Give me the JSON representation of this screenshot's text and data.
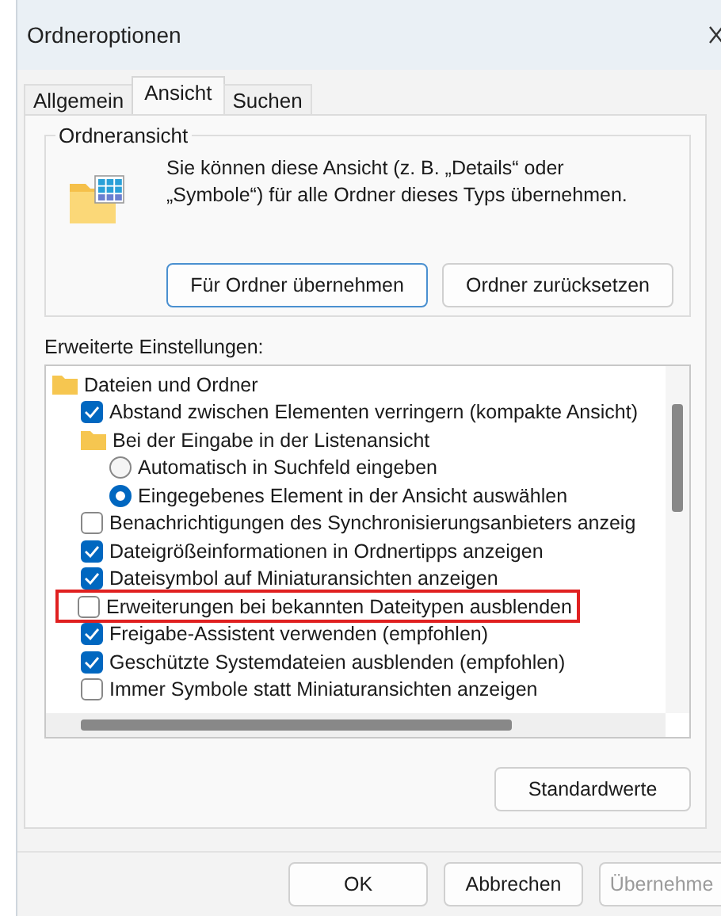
{
  "window": {
    "title": "Ordneroptionen"
  },
  "tabs": [
    {
      "label": "Allgemein",
      "selected": false
    },
    {
      "label": "Ansicht",
      "selected": true
    },
    {
      "label": "Suchen",
      "selected": false
    }
  ],
  "folder_view": {
    "title": "Ordneransicht",
    "description": "Sie können diese Ansicht (z. B. „Details“ oder „Symbole“) für alle Ordner dieses Typs übernehmen.",
    "buttons": [
      {
        "label": "Für Ordner übernehmen",
        "default": true
      },
      {
        "label": "Ordner zurücksetzen",
        "default": false
      }
    ]
  },
  "advanced": {
    "label": "Erweiterte Einstellungen:",
    "items": [
      {
        "kind": "folder",
        "label": "Dateien und Ordner",
        "children": [
          {
            "kind": "checkbox",
            "label": "Abstand zwischen Elementen verringern (kompakte Ansicht)",
            "checked": true,
            "highlighted": false
          },
          {
            "kind": "folder",
            "label": "Bei der Eingabe in der Listenansicht",
            "children": [
              {
                "kind": "radio",
                "label": "Automatisch in Suchfeld eingeben",
                "selected": false
              },
              {
                "kind": "radio",
                "label": "Eingegebenes Element in der Ansicht auswählen",
                "selected": true
              }
            ]
          },
          {
            "kind": "checkbox",
            "label": "Benachrichtigungen des Synchronisierungsanbieters anzeig",
            "checked": false,
            "highlighted": false
          },
          {
            "kind": "checkbox",
            "label": "Dateigrößeinformationen in Ordnertipps anzeigen",
            "checked": true,
            "highlighted": false
          },
          {
            "kind": "checkbox",
            "label": "Dateisymbol auf Miniaturansichten anzeigen",
            "checked": true,
            "highlighted": false
          },
          {
            "kind": "checkbox",
            "label": "Erweiterungen bei bekannten Dateitypen ausblenden",
            "checked": false,
            "highlighted": true
          },
          {
            "kind": "checkbox",
            "label": "Freigabe-Assistent verwenden (empfohlen)",
            "checked": true,
            "highlighted": false
          },
          {
            "kind": "checkbox",
            "label": "Geschützte Systemdateien ausblenden (empfohlen)",
            "checked": true,
            "highlighted": false
          },
          {
            "kind": "checkbox",
            "label": "Immer Symbole statt Miniaturansichten anzeigen",
            "checked": false,
            "highlighted": false
          }
        ]
      }
    ],
    "defaults_button": "Standardwerte"
  },
  "footer_buttons": [
    {
      "label": "OK",
      "disabled": false
    },
    {
      "label": "Abbrechen",
      "disabled": false
    },
    {
      "label": "Übernehme",
      "disabled": true
    }
  ]
}
